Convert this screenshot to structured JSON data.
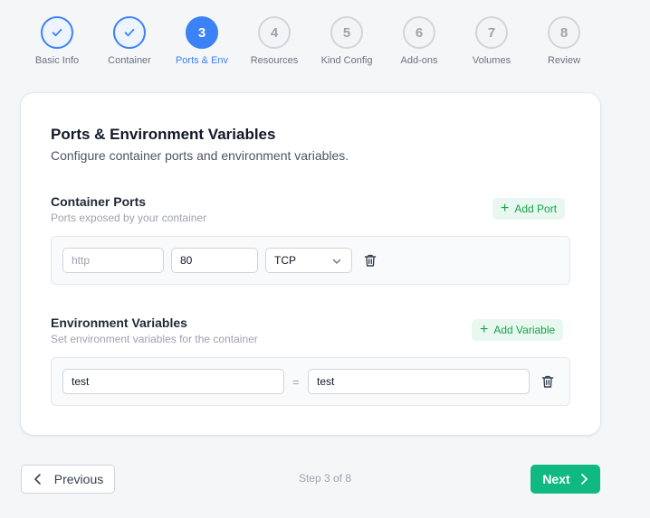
{
  "stepper": {
    "steps": [
      {
        "label": "Basic Info",
        "number": "1",
        "state": "done"
      },
      {
        "label": "Container",
        "number": "2",
        "state": "done"
      },
      {
        "label": "Ports & Env",
        "number": "3",
        "state": "active"
      },
      {
        "label": "Resources",
        "number": "4",
        "state": "todo"
      },
      {
        "label": "Kind Config",
        "number": "5",
        "state": "todo"
      },
      {
        "label": "Add-ons",
        "number": "6",
        "state": "todo"
      },
      {
        "label": "Volumes",
        "number": "7",
        "state": "todo"
      },
      {
        "label": "Review",
        "number": "8",
        "state": "todo"
      }
    ]
  },
  "card": {
    "title": "Ports & Environment Variables",
    "subtitle": "Configure container ports and environment variables."
  },
  "ports": {
    "title": "Container Ports",
    "subtitle": "Ports exposed by your container",
    "add_label": "Add Port",
    "row": {
      "name_placeholder": "http",
      "name_value": "",
      "port_value": "80",
      "protocol_value": "TCP"
    }
  },
  "env": {
    "title": "Environment Variables",
    "subtitle": "Set environment variables for the container",
    "add_label": "Add Variable",
    "row": {
      "key_value": "test",
      "separator": "=",
      "value_value": "test"
    }
  },
  "footer": {
    "previous_label": "Previous",
    "step_text": "Step 3 of 8",
    "next_label": "Next"
  },
  "colors": {
    "accent": "#3b82f6",
    "success": "#10b981",
    "success_soft": "#e8f7ef"
  }
}
